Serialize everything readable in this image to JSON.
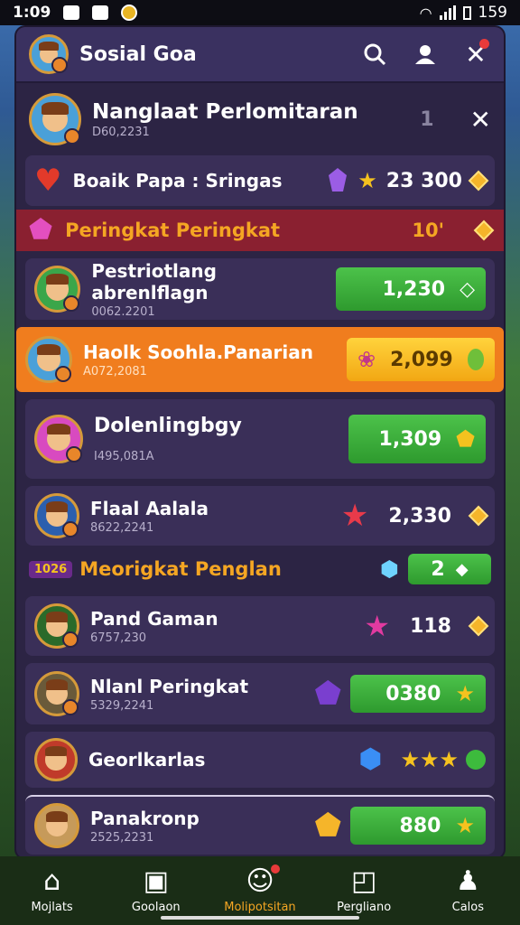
{
  "status_bar": {
    "time": "1:09",
    "battery": "159"
  },
  "header": {
    "title": "Sosial Goa"
  },
  "top_player": {
    "name": "Nanglaat Perlomitaran",
    "sub": "D60,2231",
    "rank": "1"
  },
  "banner_row": {
    "name": "Boaik Papa : Sringas",
    "value": "23 300"
  },
  "banner1": {
    "label": "Peringkat Peringkat",
    "value": "10'"
  },
  "rows": [
    {
      "name": "Pestriotlang abrenlflagn",
      "sub": "0062.2201",
      "value": "1,230"
    },
    {
      "name": "Haolk Soohla.Panarian",
      "sub": "A072,2081",
      "value": "2,099"
    },
    {
      "name": "Dolenlingbgy",
      "sub": "I495,081A",
      "value": "1,309"
    },
    {
      "name": "Flaal Aalala",
      "sub": "8622,2241",
      "value": "2,330"
    }
  ],
  "banner2": {
    "tag": "1026",
    "label": "Meorigkat Penglan",
    "value": "2"
  },
  "rows2": [
    {
      "name": "Pand Gaman",
      "sub": "6757,230",
      "value": "118"
    },
    {
      "name": "Nlanl Peringkat",
      "sub": "5329,2241",
      "value": "0380"
    },
    {
      "name": "Georlkarlas",
      "sub": "",
      "value": ""
    },
    {
      "name": "Panakronp",
      "sub": "2525,2231",
      "value": "880"
    }
  ],
  "nav": [
    {
      "label": "Mojlats",
      "icon": "home-icon"
    },
    {
      "label": "Goolaon",
      "icon": "clipboard-icon"
    },
    {
      "label": "Molipotsitan",
      "icon": "social-icon"
    },
    {
      "label": "Pergliano",
      "icon": "search-doc-icon"
    },
    {
      "label": "Calos",
      "icon": "profile-icon"
    }
  ],
  "colors": {
    "panel": "#2c2444",
    "green": "#3dbb3d",
    "orange": "#f07d1e",
    "banner_red": "#8a2030"
  }
}
